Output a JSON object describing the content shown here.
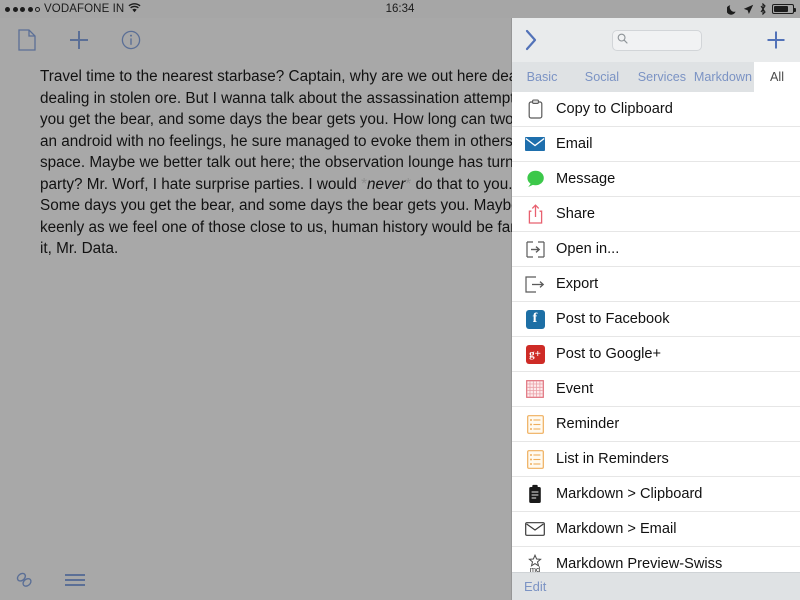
{
  "status_bar": {
    "signal_dots": 5,
    "signal_filled": 4,
    "carrier": "VODAFONE IN",
    "wifi_icon": "wifi-icon",
    "time": "16:34",
    "dnd_icon": "moon-do-not-disturb-icon",
    "location_icon": "location-arrow-icon",
    "bluetooth_icon": "bluetooth-icon",
    "battery_icon": "battery-icon",
    "battery_level_pct": 72
  },
  "editor": {
    "toolbar": [
      {
        "name": "new-document-button",
        "icon": "document-icon"
      },
      {
        "name": "add-button",
        "icon": "plus-icon"
      },
      {
        "name": "info-button",
        "icon": "info-circle-icon"
      }
    ],
    "bottom_toolbar": [
      {
        "name": "link-button",
        "icon": "link-chain-icon"
      },
      {
        "name": "menu-button",
        "icon": "hamburger-menu-icon"
      }
    ],
    "lines": [
      "Travel time to the nearest starbase? Captain, why are we out here dealing in stolen ore",
      "dealing in stolen ore. But I wanna talk about the assassination attempt. Some days",
      "you get the bear, and some days the bear gets you. How long can two people talk",
      "an android with no feelings, he sure managed to evoke them in others. Space, the",
      "space. Maybe we better talk out here; the observation lounge has turned into a"
    ],
    "line_before_em": "party? Mr. Worf, I hate surprise parties. I would ",
    "em_open": "*",
    "em_text": "never",
    "em_close": "*",
    "line_after_em": " do that to you. How",
    "lines_tail": [
      "Some days you get the bear, and some days the bear gets you. Maybe if we felt any",
      "keenly as we feel one of those close to us, human history would be far less bloody",
      "it, Mr. Data."
    ]
  },
  "panel": {
    "back_icon": "chevron-right-icon",
    "search": {
      "icon": "search-icon",
      "placeholder": "",
      "value": ""
    },
    "add_icon": "plus-icon",
    "tabs": [
      {
        "label": "Basic",
        "active": false
      },
      {
        "label": "Social",
        "active": false
      },
      {
        "label": "Services",
        "active": false
      },
      {
        "label": "Markdown",
        "active": false
      },
      {
        "label": "All",
        "active": true
      }
    ],
    "actions": [
      {
        "label": "Copy to Clipboard",
        "icon": "clipboard-outline-icon"
      },
      {
        "label": "Email",
        "icon": "envelope-filled-blue-icon"
      },
      {
        "label": "Message",
        "icon": "message-bubble-green-icon"
      },
      {
        "label": "Share",
        "icon": "share-up-arrow-red-icon"
      },
      {
        "label": "Open in...",
        "icon": "open-in-box-arrow-icon"
      },
      {
        "label": "Export",
        "icon": "export-box-arrow-icon"
      },
      {
        "label": "Post to Facebook",
        "icon": "facebook-icon"
      },
      {
        "label": "Post to Google+",
        "icon": "google-plus-icon"
      },
      {
        "label": "Event",
        "icon": "calendar-grid-red-icon"
      },
      {
        "label": "Reminder",
        "icon": "reminders-list-orange-icon"
      },
      {
        "label": "List in Reminders",
        "icon": "reminders-list-orange-icon"
      },
      {
        "label": "Markdown > Clipboard",
        "icon": "clipboard-filled-black-icon"
      },
      {
        "label": "Markdown > Email",
        "icon": "envelope-outline-icon"
      },
      {
        "label": "Markdown Preview-Swiss",
        "icon": "markdown-preview-icon"
      }
    ],
    "footer": {
      "edit_label": "Edit"
    }
  },
  "colors": {
    "accent_blue": "#5272b8",
    "tab_inactive": "#7b93c4",
    "panel_chrome": "#dfe2e4",
    "editor_bg": "#a8a8a8"
  }
}
